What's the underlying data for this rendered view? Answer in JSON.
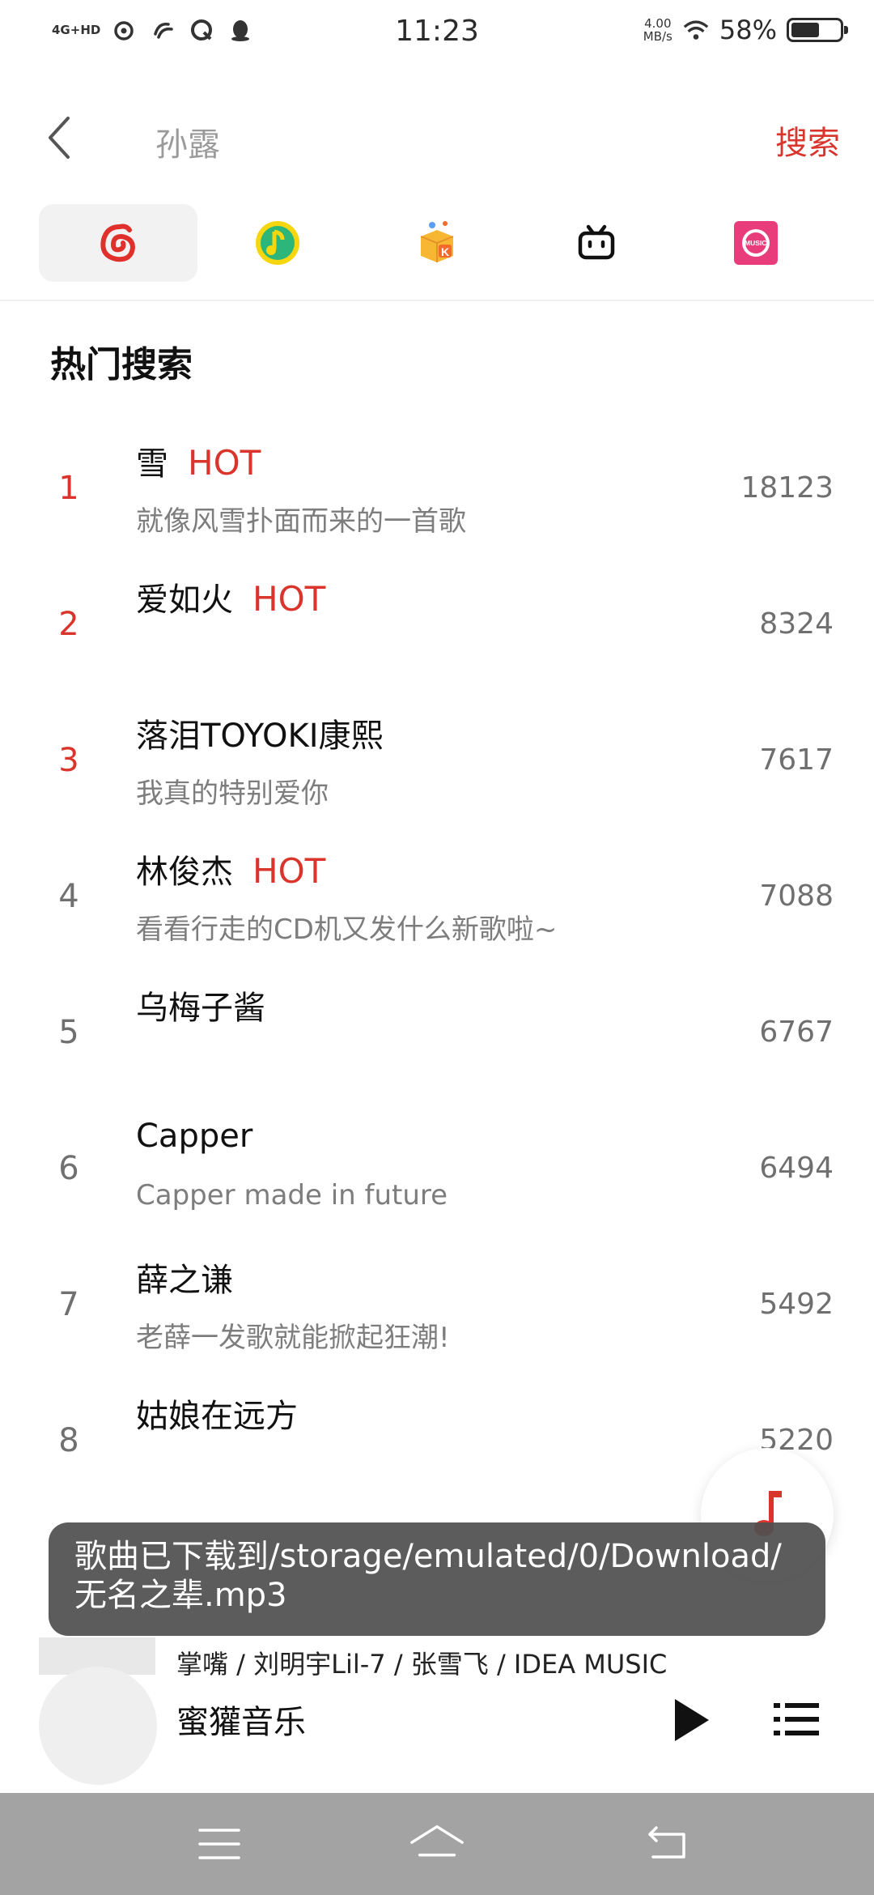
{
  "status_bar": {
    "network": "4G+HD",
    "time": "11:23",
    "speed_value": "4.00",
    "speed_unit": "MB/s",
    "battery_percent": "58%",
    "battery_level": 0.58
  },
  "header": {
    "query": "孙露",
    "search_label": "搜索"
  },
  "sources": [
    {
      "icon": "netease-music-icon",
      "active": true
    },
    {
      "icon": "qq-music-icon",
      "active": false
    },
    {
      "icon": "kugou-music-icon",
      "active": false
    },
    {
      "icon": "bilibili-icon",
      "active": false
    },
    {
      "icon": "migu-music-icon",
      "active": false
    }
  ],
  "section_title": "热门搜索",
  "hot_list": [
    {
      "rank": "1",
      "title": "雪",
      "hot": "HOT",
      "subtitle": "就像风雪扑面而来的一首歌",
      "count": "18123"
    },
    {
      "rank": "2",
      "title": "爱如火",
      "hot": "HOT",
      "subtitle": "",
      "count": "8324"
    },
    {
      "rank": "3",
      "title": "落泪TOYOKI康熙",
      "hot": "",
      "subtitle": "我真的特别爱你",
      "count": "7617"
    },
    {
      "rank": "4",
      "title": "林俊杰",
      "hot": "HOT",
      "subtitle": "看看行走的CD机又发什么新歌啦~",
      "count": "7088"
    },
    {
      "rank": "5",
      "title": "乌梅子酱",
      "hot": "",
      "subtitle": "",
      "count": "6767"
    },
    {
      "rank": "6",
      "title": "Capper",
      "hot": "",
      "subtitle": "Capper made in future",
      "count": "6494"
    },
    {
      "rank": "7",
      "title": "薛之谦",
      "hot": "",
      "subtitle": "老薛一发歌就能掀起狂潮!",
      "count": "5492"
    },
    {
      "rank": "8",
      "title": "姑娘在远方",
      "hot": "",
      "subtitle": "",
      "count": "5220"
    }
  ],
  "player": {
    "artists": "掌嘴 / 刘明宇Lil-7 / 张雪飞 / IDEA MUSIC",
    "title": "蜜獾音乐"
  },
  "toast": {
    "message": "歌曲已下载到/storage/emulated/0/Download/无名之辈.mp3"
  },
  "colors": {
    "accent": "#d9352c",
    "navbar": "#a3a3a3"
  }
}
